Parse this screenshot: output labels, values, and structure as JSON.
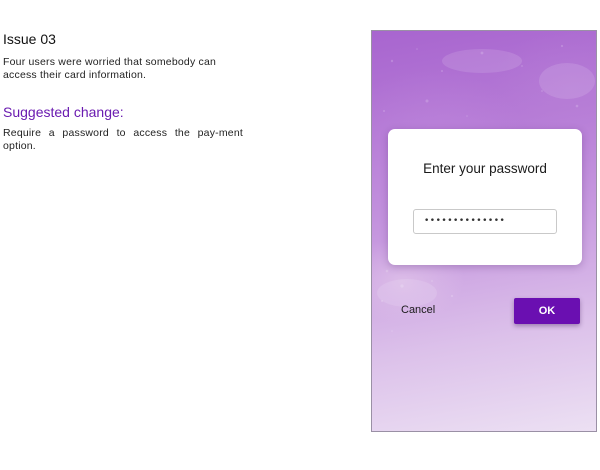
{
  "notes": {
    "issue_title": "Issue 03",
    "issue_description": "Four users were worried that somebody can access their card information.",
    "suggested_heading": "Suggested change:",
    "suggested_description": "Require a password to access the pay-ment option."
  },
  "dialog": {
    "title": "Enter your password",
    "password_value": "••••••••••••••",
    "cancel_label": "Cancel",
    "ok_label": "OK"
  },
  "colors": {
    "accent": "#6a0fb1",
    "heading_purple": "#6a1bb0",
    "background_top": "#a865cf",
    "background_bottom": "#ece0f3"
  }
}
